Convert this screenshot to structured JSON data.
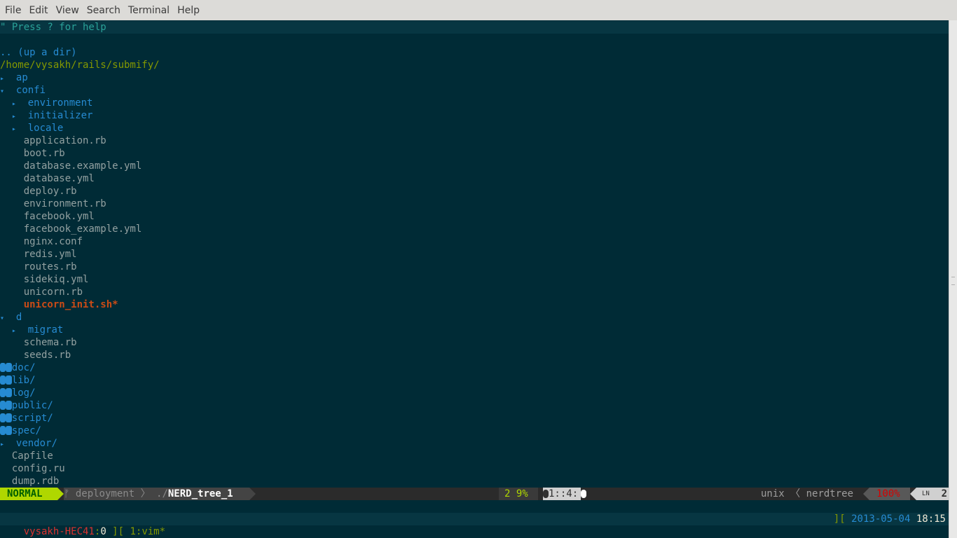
{
  "menubar": {
    "items": [
      "File",
      "Edit",
      "View",
      "Search",
      "Terminal",
      "Help"
    ]
  },
  "nerdtree": {
    "help_line": "\" Press ? for help",
    "up_dir": ".. (up a dir)",
    "root": "/home/vysakh/rails/submify/",
    "entries": [
      {
        "indent": 0,
        "type": "dir-closed",
        "marker": "▸",
        "name": "ap"
      },
      {
        "indent": 0,
        "type": "dir-open",
        "marker": "▾",
        "name": "confi"
      },
      {
        "indent": 1,
        "type": "dir-closed",
        "marker": "▸",
        "name": "environment"
      },
      {
        "indent": 1,
        "type": "dir-closed",
        "marker": "▸",
        "name": "initializer"
      },
      {
        "indent": 1,
        "type": "dir-closed",
        "marker": "▸",
        "name": "locale"
      },
      {
        "indent": 1,
        "type": "file",
        "name": "application.rb"
      },
      {
        "indent": 1,
        "type": "file",
        "name": "boot.rb"
      },
      {
        "indent": 1,
        "type": "file",
        "name": "database.example.yml"
      },
      {
        "indent": 1,
        "type": "file",
        "name": "database.yml"
      },
      {
        "indent": 1,
        "type": "file",
        "name": "deploy.rb"
      },
      {
        "indent": 1,
        "type": "file",
        "name": "environment.rb"
      },
      {
        "indent": 1,
        "type": "file",
        "name": "facebook.yml"
      },
      {
        "indent": 1,
        "type": "file",
        "name": "facebook_example.yml"
      },
      {
        "indent": 1,
        "type": "file",
        "name": "nginx.conf"
      },
      {
        "indent": 1,
        "type": "file",
        "name": "redis.yml"
      },
      {
        "indent": 1,
        "type": "file",
        "name": "routes.rb"
      },
      {
        "indent": 1,
        "type": "file",
        "name": "sidekiq.yml"
      },
      {
        "indent": 1,
        "type": "file",
        "name": "unicorn.rb"
      },
      {
        "indent": 1,
        "type": "exe",
        "name": "unicorn_init.sh*"
      },
      {
        "indent": 0,
        "type": "dir-open",
        "marker": "▾",
        "name": "d"
      },
      {
        "indent": 1,
        "type": "dir-closed",
        "marker": "▸",
        "name": "migrat"
      },
      {
        "indent": 1,
        "type": "file",
        "name": "schema.rb"
      },
      {
        "indent": 1,
        "type": "file",
        "name": "seeds.rb"
      },
      {
        "indent": 0,
        "type": "glitch",
        "name": "doc/"
      },
      {
        "indent": 0,
        "type": "glitch",
        "name": "lib/"
      },
      {
        "indent": 0,
        "type": "glitch",
        "name": "log/"
      },
      {
        "indent": 0,
        "type": "glitch",
        "name": "public/"
      },
      {
        "indent": 0,
        "type": "glitch",
        "name": "script/"
      },
      {
        "indent": 0,
        "type": "glitch",
        "name": "spec/"
      },
      {
        "indent": 0,
        "type": "dir-closed",
        "marker": "▸",
        "name": "vendor/"
      },
      {
        "indent": 0,
        "type": "rootfile",
        "name": "Capfile"
      },
      {
        "indent": 0,
        "type": "rootfile",
        "name": "config.ru"
      },
      {
        "indent": 0,
        "type": "rootfile",
        "name": "dump.rdb"
      }
    ]
  },
  "statusline": {
    "mode": "NORMAL",
    "branch_icon": "ᚠ",
    "branch": "deployment",
    "path_prefix": "./",
    "filename": "NERD_tree_1",
    "warning": "2 9%",
    "position": "1::4:",
    "fileformat": "unix",
    "separator": "〈",
    "filetype": "nerdtree",
    "percent": "100%",
    "line_icon": "LN",
    "line_number": "2"
  },
  "cmdline": {
    "row": "3",
    "col": "1"
  },
  "tmux": {
    "host": "vysakh-HEC41",
    "session": "0",
    "bracket_left": " ][ ",
    "window": "1:vim*",
    "bracket_right": "][ ",
    "date": "2013-05-04",
    "time": "18:15"
  },
  "colors": {
    "background": "#002b36",
    "directory": "#268bd2",
    "file": "#93a1a1",
    "executable": "#cb4b16",
    "root": "#859900",
    "mode_bg": "#afd700"
  }
}
